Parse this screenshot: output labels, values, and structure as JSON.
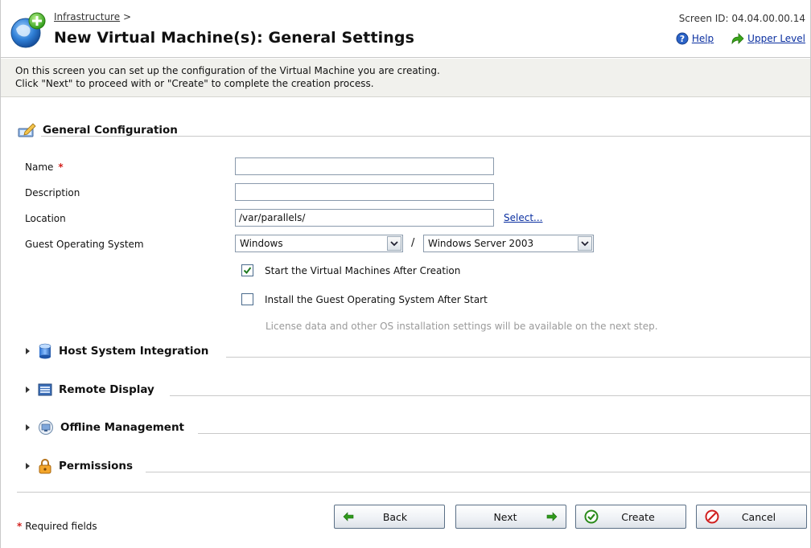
{
  "header": {
    "breadcrumb": "Infrastructure",
    "breadcrumb_sep": ">",
    "title": "New Virtual Machine(s): General Settings",
    "screen_id": "Screen ID: 04.04.00.00.14",
    "help_label": "Help",
    "upper_level_label": "Upper Level"
  },
  "description": {
    "line1": "On this screen you can set up the configuration of the Virtual Machine you are creating.",
    "line2": "Click \"Next\" to proceed with or \"Create\" to complete the creation process."
  },
  "general": {
    "title": "General Configuration",
    "name_label": "Name",
    "required_mark": "*",
    "name_value": "",
    "description_label": "Description",
    "description_value": "",
    "location_label": "Location",
    "location_value": "/var/parallels/",
    "select_link": "Select...",
    "guest_os_label": "Guest Operating System",
    "guest_os_family": "Windows",
    "os_separator": "/",
    "guest_os_version": "Windows Server 2003",
    "start_after_creation_label": "Start the Virtual Machines After Creation",
    "start_after_creation_checked": true,
    "install_guest_os_label": "Install the Guest Operating System After Start",
    "install_guest_os_checked": false,
    "hint": "License data and other OS installation settings will be available on the next step."
  },
  "sections": {
    "host_integration": "Host System Integration",
    "remote_display": "Remote Display",
    "offline_management": "Offline Management",
    "permissions": "Permissions"
  },
  "footer": {
    "required_star": "*",
    "required_note": "Required fields",
    "back": "Back",
    "next": "Next",
    "create": "Create",
    "cancel": "Cancel"
  },
  "colors": {
    "accent_link": "#0a2fa0",
    "required": "#d3221f",
    "desc_bg": "#f1f1ed"
  }
}
